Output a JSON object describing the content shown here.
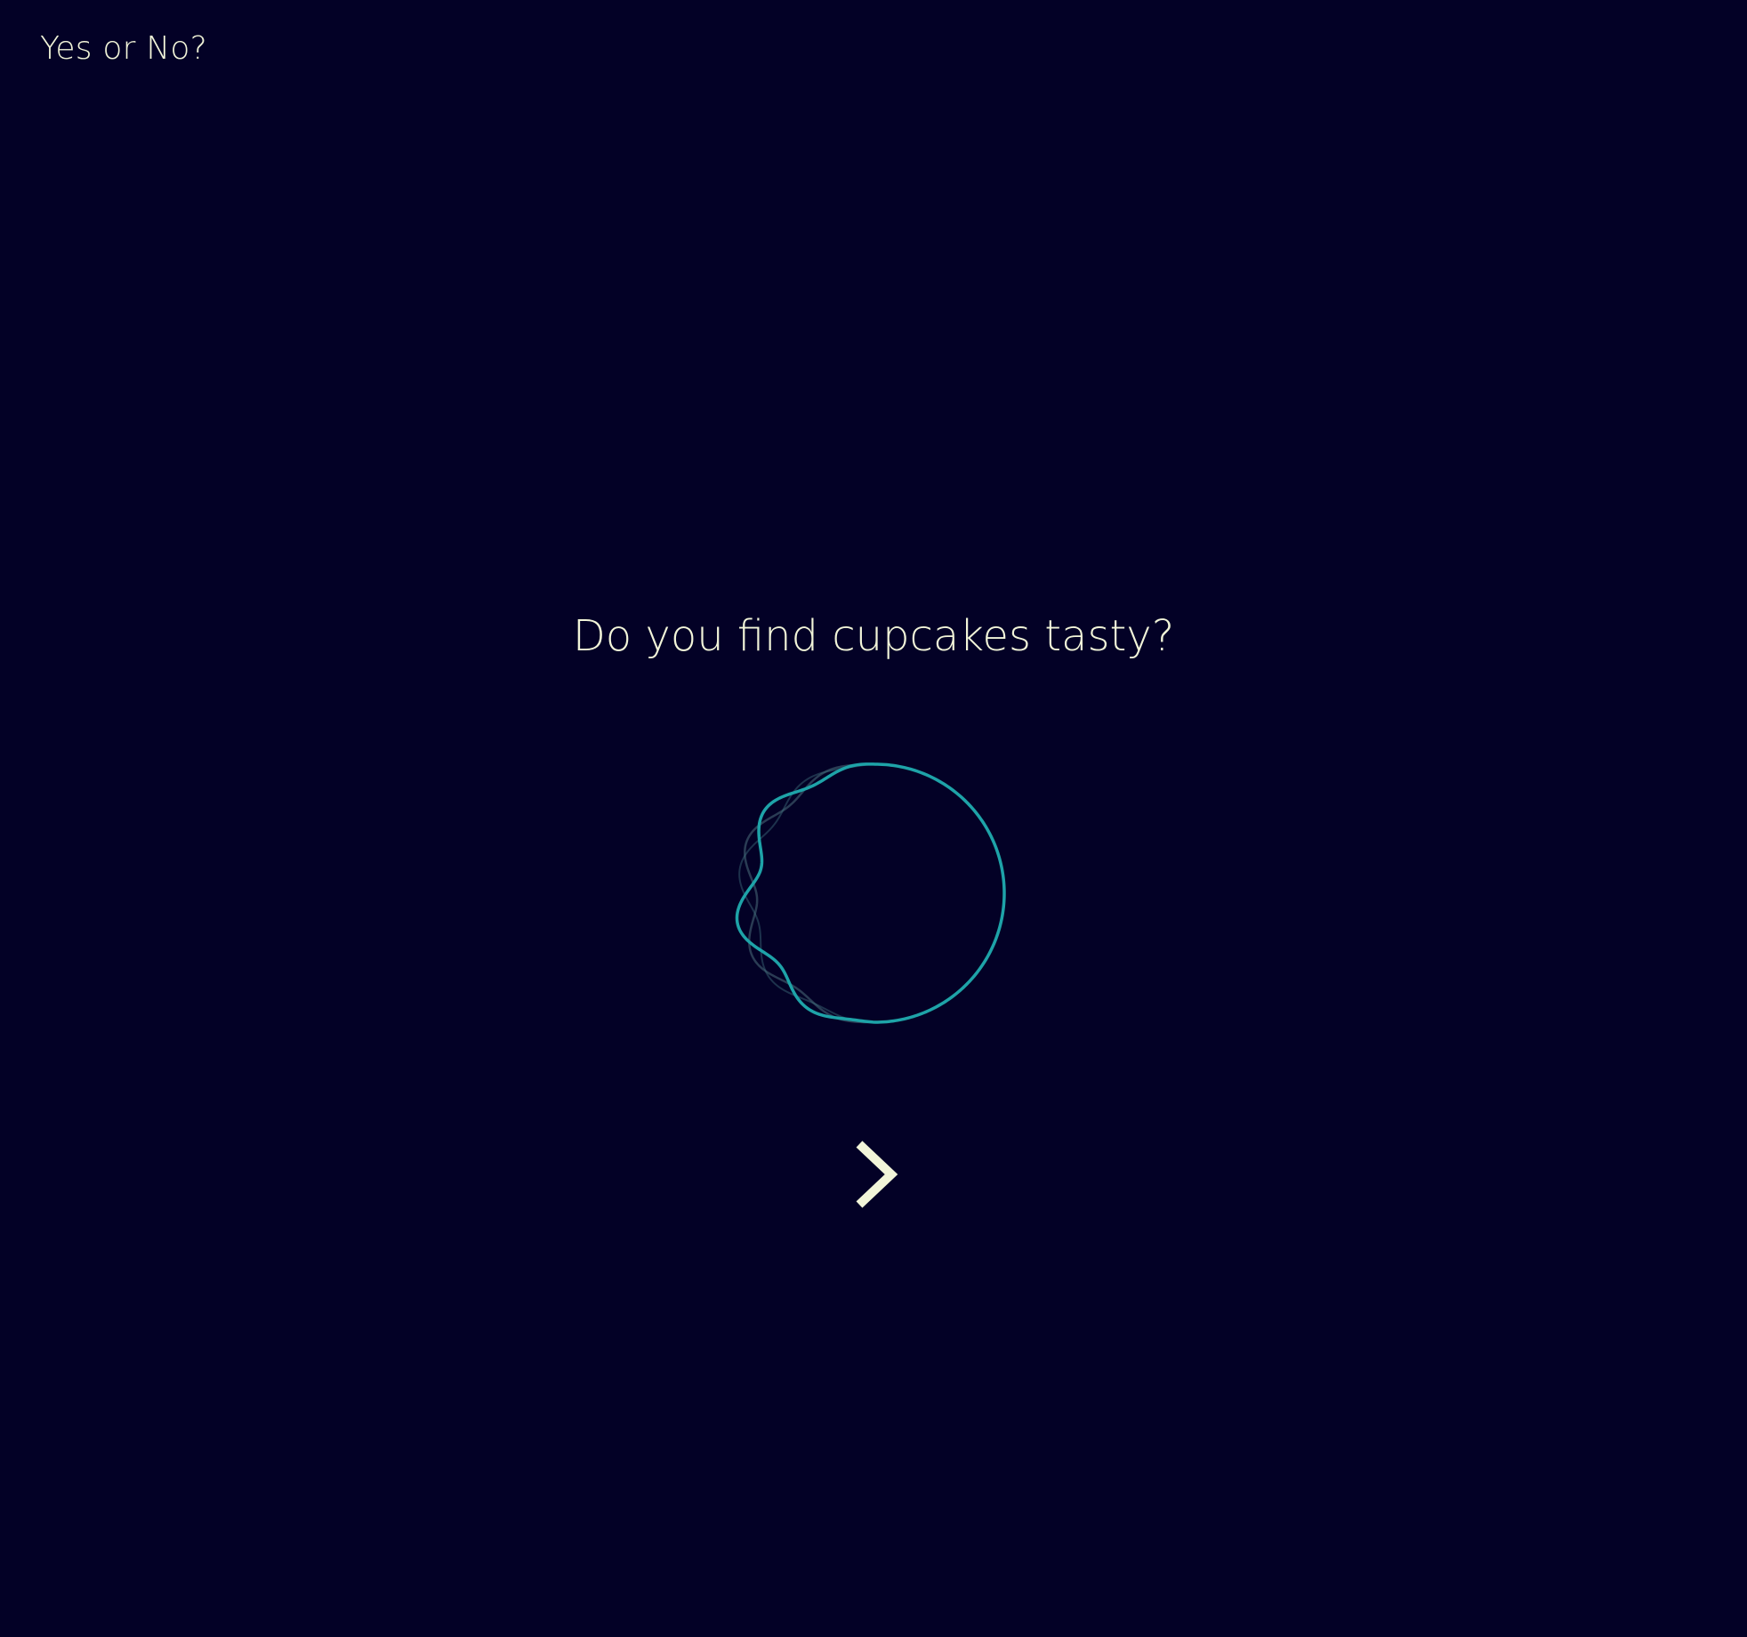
{
  "app": {
    "title": "Yes or No?"
  },
  "prompt": {
    "question": "Do you find cupcakes tasty?"
  },
  "orb": {
    "icon": "waveform-circle-icon",
    "color_primary": "#1ea3a8",
    "color_faded": "#4a6e7a"
  },
  "next": {
    "icon": "chevron-right-icon",
    "color": "#f2f5d9"
  },
  "colors": {
    "background": "#030126",
    "text": "#f2f5d9"
  }
}
